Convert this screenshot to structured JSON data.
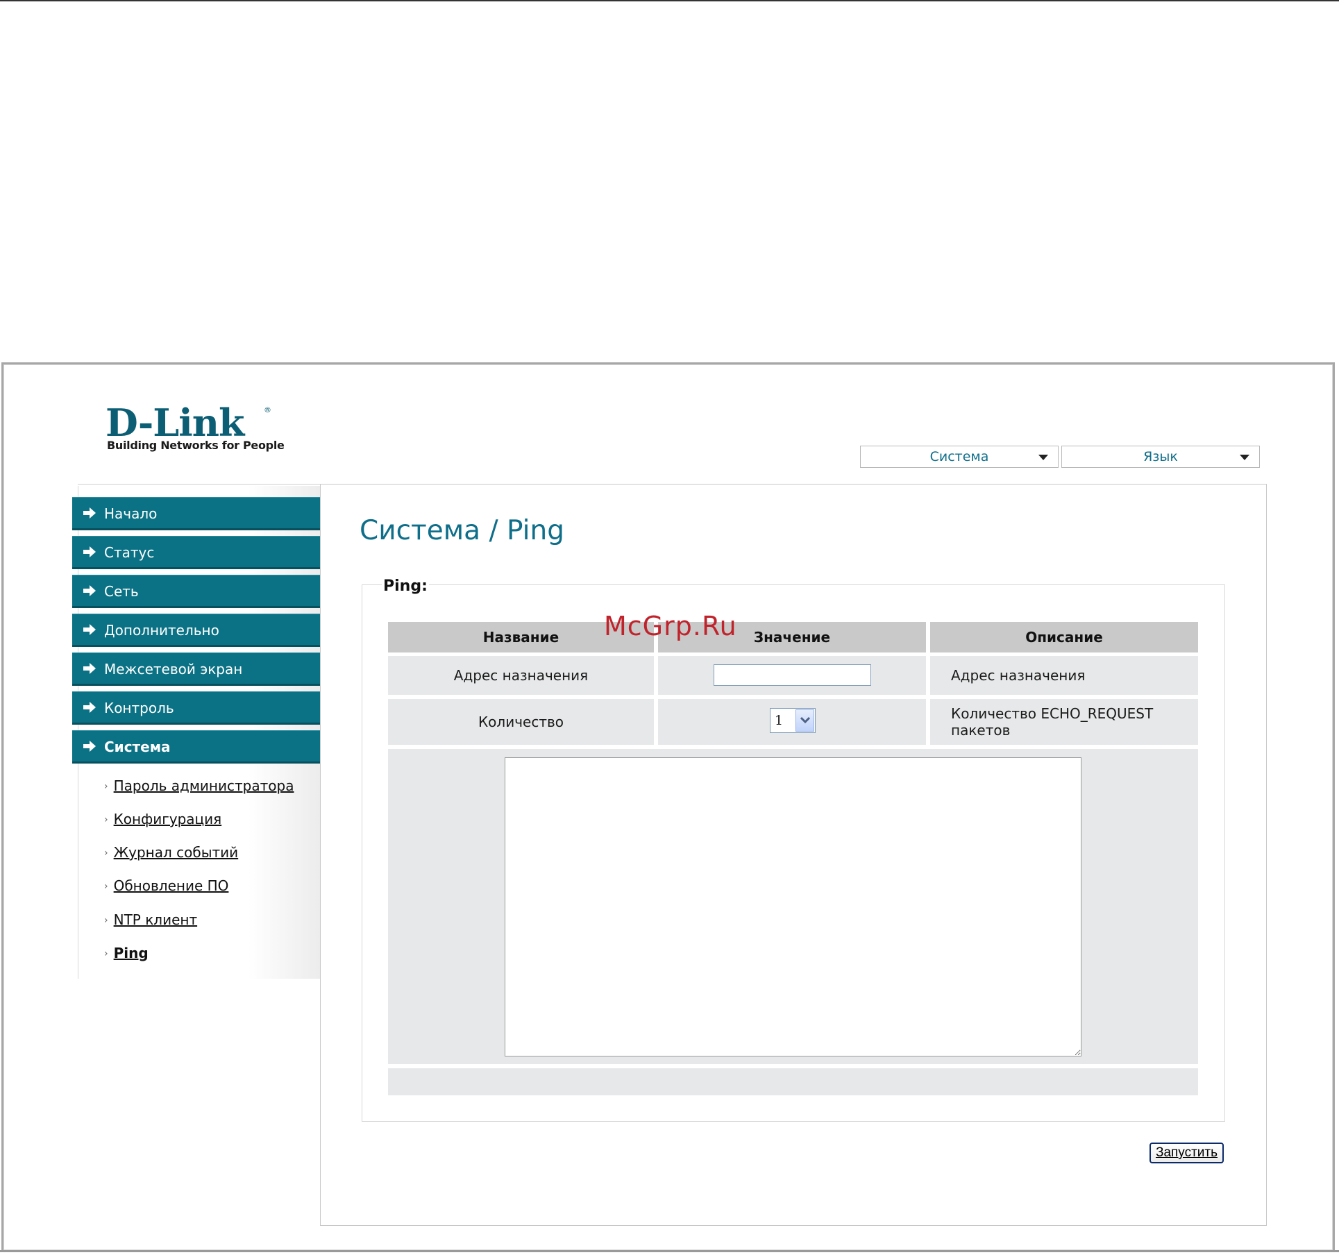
{
  "brand": {
    "name": "D-Link",
    "reg": "®",
    "tagline": "Building Networks for People"
  },
  "top_menus": {
    "system": "Система",
    "language": "Язык"
  },
  "nav": {
    "items": [
      {
        "label": "Начало"
      },
      {
        "label": "Статус"
      },
      {
        "label": "Сеть"
      },
      {
        "label": "Дополнительно"
      },
      {
        "label": "Межсетевой экран"
      },
      {
        "label": "Контроль"
      },
      {
        "label": "Система"
      }
    ],
    "sub_items": [
      {
        "label": "Пароль администратора"
      },
      {
        "label": "Конфигурация"
      },
      {
        "label": "Журнал событий"
      },
      {
        "label": "Обновление ПО"
      },
      {
        "label": "NTP клиент"
      },
      {
        "label": "Ping"
      }
    ]
  },
  "page": {
    "title": "Система / Ping",
    "section_legend": "Ping:"
  },
  "table": {
    "headers": [
      "Название",
      "Значение",
      "Описание"
    ],
    "rows": [
      {
        "name": "Адрес назначения",
        "value": "",
        "description": "Адрес назначения"
      },
      {
        "name": "Количество",
        "value": "1",
        "description": "Количество ECHO_REQUEST пакетов"
      }
    ]
  },
  "actions": {
    "run_label": "Запустить"
  },
  "watermark": "McGrp.Ru",
  "colors": {
    "nav_bg": "#0b7285",
    "accent_text": "#0f6e8a",
    "header_cell": "#c9c9c9",
    "body_cell": "#e7e8e9"
  }
}
